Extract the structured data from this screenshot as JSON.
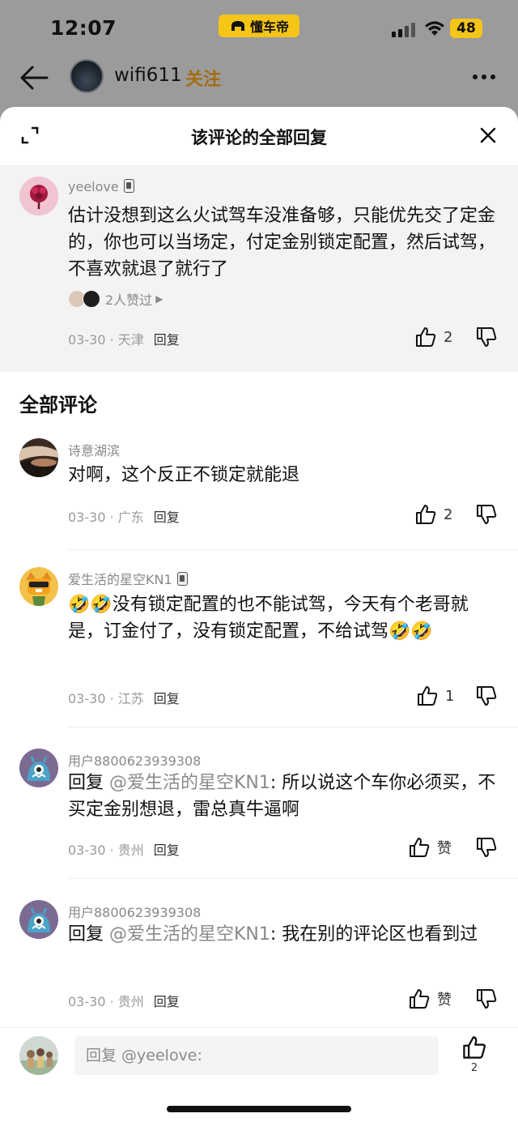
{
  "status_bar": {
    "time": "12:07",
    "app_name": "懂车帝",
    "battery": "48"
  },
  "top_bar": {
    "username": "wifi611",
    "follow_label": "关注"
  },
  "sheet": {
    "title": "该评论的全部回复"
  },
  "main_comment": {
    "username": "yeelove",
    "text": "估计没想到这么火试驾车没准备够，只能优先交了定金的，你也可以当场定，付定金别锁定配置，然后试驾，不喜欢就退了就行了",
    "likers_text": "2人赞过",
    "date": "03-30 · 天津",
    "reply_label": "回复",
    "like_count": "2"
  },
  "section_title": "全部评论",
  "comments": [
    {
      "username": "诗意湖滨",
      "text": "对啊，这个反正不锁定就能退",
      "date": "03-30 · 广东",
      "reply_label": "回复",
      "like_count": "2"
    },
    {
      "username": "爱生活的星空KN1",
      "text": "🤣🤣没有锁定配置的也不能试驾，今天有个老哥就是，订金付了，没有锁定配置，不给试驾🤣🤣",
      "date": "03-30 · 江苏",
      "reply_label": "回复",
      "like_count": "1"
    },
    {
      "username": "用户8800623939308",
      "reply_prefix": "回复 ",
      "mention": "@爱生活的星空KN1",
      "text": ": 所以说这个车你必须买，不买定金别想退，雷总真牛逼啊",
      "date": "03-30 · 贵州",
      "reply_label": "回复",
      "like_label": "赞"
    },
    {
      "username": "用户8800623939308",
      "reply_prefix": "回复 ",
      "mention": "@爱生活的星空KN1",
      "text": ": 我在别的评论区也看到过",
      "date": "03-30 · 贵州",
      "reply_label": "回复",
      "like_label": "赞"
    }
  ],
  "footer": {
    "placeholder": "回复 @yeelove:",
    "like_count": "2"
  },
  "colors": {
    "follow": "#a36d10",
    "accent_yellow": "#f5c518",
    "mention": "#8a8a8a"
  }
}
